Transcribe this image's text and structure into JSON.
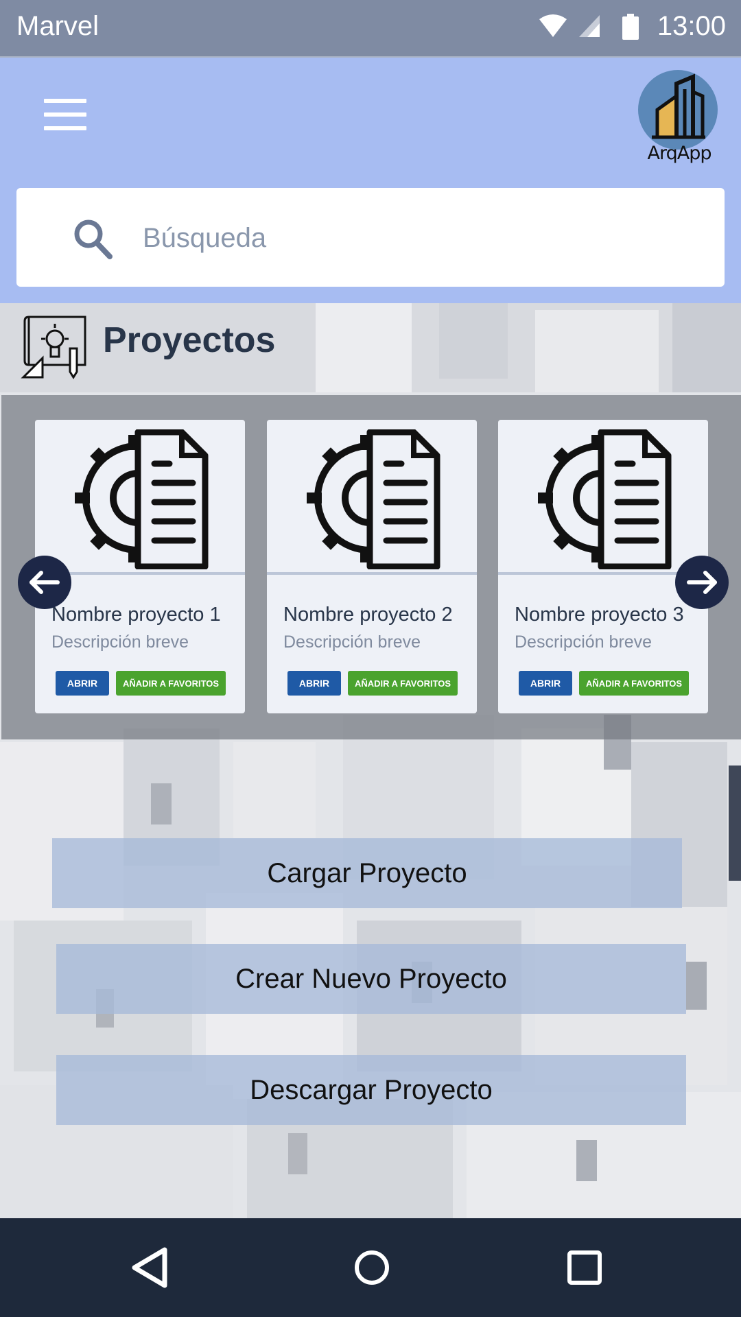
{
  "status_bar": {
    "carrier": "Marvel",
    "time": "13:00"
  },
  "header": {
    "logo_text": "ArqApp"
  },
  "search": {
    "placeholder": "Búsqueda",
    "value": ""
  },
  "section": {
    "title": "Proyectos"
  },
  "projects": [
    {
      "title": "Nombre proyecto 1",
      "description": "Descripción breve",
      "open_label": "ABRIR",
      "fav_label": "AÑADIR A FAVORITOS"
    },
    {
      "title": "Nombre proyecto 2",
      "description": "Descripción breve",
      "open_label": "ABRIR",
      "fav_label": "AÑADIR A FAVORITOS"
    },
    {
      "title": "Nombre proyecto 3",
      "description": "Descripción breve",
      "open_label": "ABRIR",
      "fav_label": "AÑADIR A FAVORITOS"
    }
  ],
  "actions": {
    "load": "Cargar Proyecto",
    "create": "Crear Nuevo Proyecto",
    "download": "Descargar Proyecto"
  },
  "icons": {
    "menu": "hamburger-menu-icon",
    "search": "search-icon",
    "section": "blueprint-icon",
    "card": "gear-document-icon",
    "prev": "arrow-left-icon",
    "next": "arrow-right-icon"
  },
  "colors": {
    "status_bar": "#7f8ba3",
    "header": "#a7bcf2",
    "open_button": "#1f5aa6",
    "fav_button": "#4aa32e",
    "nav_bar": "#1e293b",
    "carousel_arrow": "#1d2747"
  }
}
